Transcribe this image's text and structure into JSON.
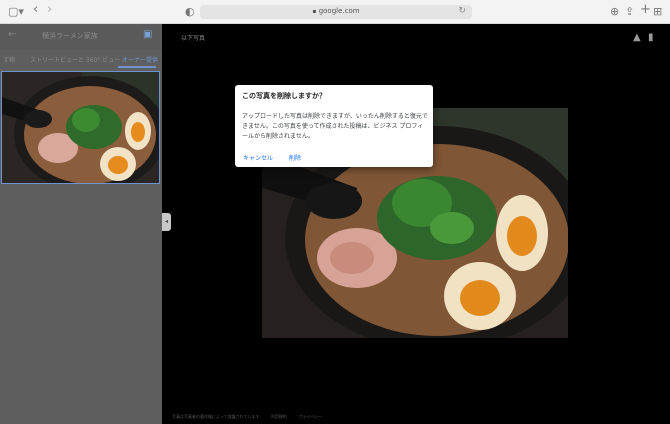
{
  "browser": {
    "url": "google.com",
    "sidebar_icon": "sidebar-icon",
    "back_icon": "‹",
    "forward_icon": "›",
    "shield_icon": "◐",
    "lock_icon": "🔒",
    "reload_icon": "↻",
    "download_icon": "⊕",
    "share_icon": "⇪",
    "plus_icon": "+",
    "tabs_icon": "⊞"
  },
  "left_panel": {
    "back_icon": "←",
    "title": "横浜ラーメン家族",
    "add_photo_icon": "▣",
    "tabs": [
      {
        "label": "す物"
      },
      {
        "label": "ストリートビューと 360° ビュー"
      },
      {
        "label": "オーナー提供"
      }
    ]
  },
  "viewer": {
    "label": "以下写真",
    "thumbs_up_icon": "👍",
    "trash_icon": "🗑"
  },
  "footer": {
    "items": [
      "写真は写真者の著作権によって保護されています",
      "利用規約",
      "プライバシー"
    ]
  },
  "dialog": {
    "title": "この写真を削除しますか？",
    "body": "アップロードした写真は削除できますが、いったん削除すると復元できません。この写真を使って作成された投稿は、ビジネス プロフィールから削除されません。",
    "cancel_label": "キャンセル",
    "delete_label": "削除"
  },
  "colors": {
    "accent": "#1a73e8",
    "overlay": "#5e5e5e",
    "viewer_bg": "#000000"
  }
}
